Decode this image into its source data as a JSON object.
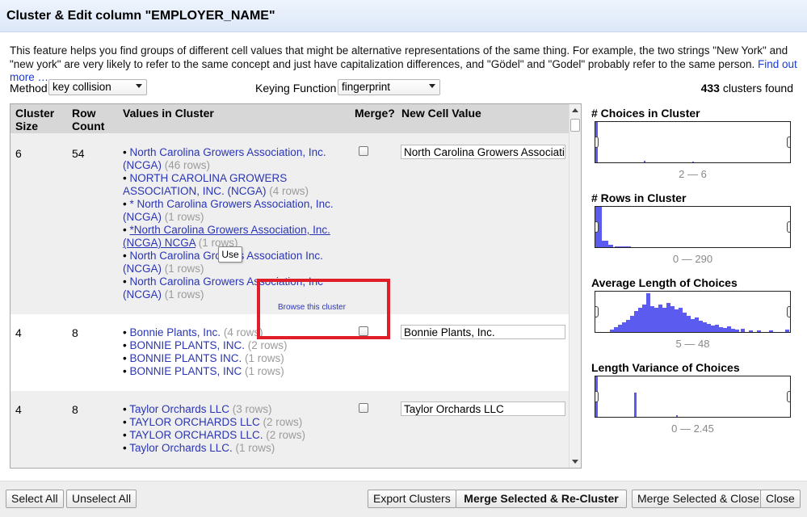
{
  "dialog": {
    "title": "Cluster & Edit column \"EMPLOYER_NAME\""
  },
  "description": {
    "text": "This feature helps you find groups of different cell values that might be alternative representations of the same thing. For example, the two strings \"New York\" and \"new york\" are very likely to refer to the same concept and just have capitalization differences, and \"Gödel\" and \"Godel\" probably refer to the same person.",
    "link": "Find out more …"
  },
  "controls": {
    "method_label": "Method",
    "method_value": "key collision",
    "keying_label": "Keying Function",
    "keying_value": "fingerprint",
    "clusters_count": "433",
    "clusters_suffix": "clusters found"
  },
  "table": {
    "headers": {
      "cluster_size": "Cluster Size",
      "row_count": "Row Count",
      "values": "Values in Cluster",
      "merge": "Merge?",
      "new_value": "New Cell Value"
    },
    "rows": [
      {
        "size": "6",
        "count": "54",
        "values": [
          {
            "text": "North Carolina Growers Association, Inc. (NCGA)",
            "count": "(46 rows)"
          },
          {
            "text": "NORTH CAROLINA GROWERS ASSOCIATION, INC. (NCGA)",
            "count": "(4 rows)"
          },
          {
            "text": "* North Carolina Growers Association, Inc. (NCGA)",
            "count": "(1 rows)"
          },
          {
            "text": "*North Carolina Growers Association, Inc. (NCGA) NCGA",
            "count": "(1 rows)"
          },
          {
            "text": "North Carolina Growers Association Inc. (NCGA)",
            "count": "(1 rows)"
          },
          {
            "text": "North Carolina Growers Association, Inc (NCGA)",
            "count": "(1 rows)"
          }
        ],
        "new_value": "North Carolina Growers Association, Inc. (NCGA)"
      },
      {
        "size": "4",
        "count": "8",
        "values": [
          {
            "text": "Bonnie Plants, Inc.",
            "count": "(4 rows)"
          },
          {
            "text": "BONNIE PLANTS, INC.",
            "count": "(2 rows)"
          },
          {
            "text": "BONNIE PLANTS INC.",
            "count": "(1 rows)"
          },
          {
            "text": "BONNIE PLANTS, INC",
            "count": "(1 rows)"
          }
        ],
        "new_value": "Bonnie Plants, Inc."
      },
      {
        "size": "4",
        "count": "8",
        "values": [
          {
            "text": "Taylor Orchards LLC",
            "count": "(3 rows)"
          },
          {
            "text": "TAYLOR ORCHARDS LLC",
            "count": "(2 rows)"
          },
          {
            "text": "TAYLOR ORCHARDS LLC.",
            "count": "(2 rows)"
          },
          {
            "text": "Taylor Orchards LLC.",
            "count": "(1 rows)"
          }
        ],
        "new_value": "Taylor Orchards LLC"
      }
    ],
    "tooltip": "Use",
    "browse_link": "Browse this cluster"
  },
  "histograms": [
    {
      "title": "# Choices in Cluster",
      "range": "2 — 6"
    },
    {
      "title": "# Rows in Cluster",
      "range": "0 — 290"
    },
    {
      "title": "Average Length of Choices",
      "range": "5 — 48"
    },
    {
      "title": "Length Variance of Choices",
      "range": "0 — 2.45"
    }
  ],
  "footer": {
    "select_all": "Select All",
    "unselect_all": "Unselect All",
    "export": "Export Clusters",
    "merge_recluster": "Merge Selected & Re-Cluster",
    "merge_close": "Merge Selected & Close",
    "close": "Close"
  },
  "colors": {
    "bar": "#5b5bf0",
    "link": "#2a35b5",
    "highlight_box": "#e01e2a"
  }
}
